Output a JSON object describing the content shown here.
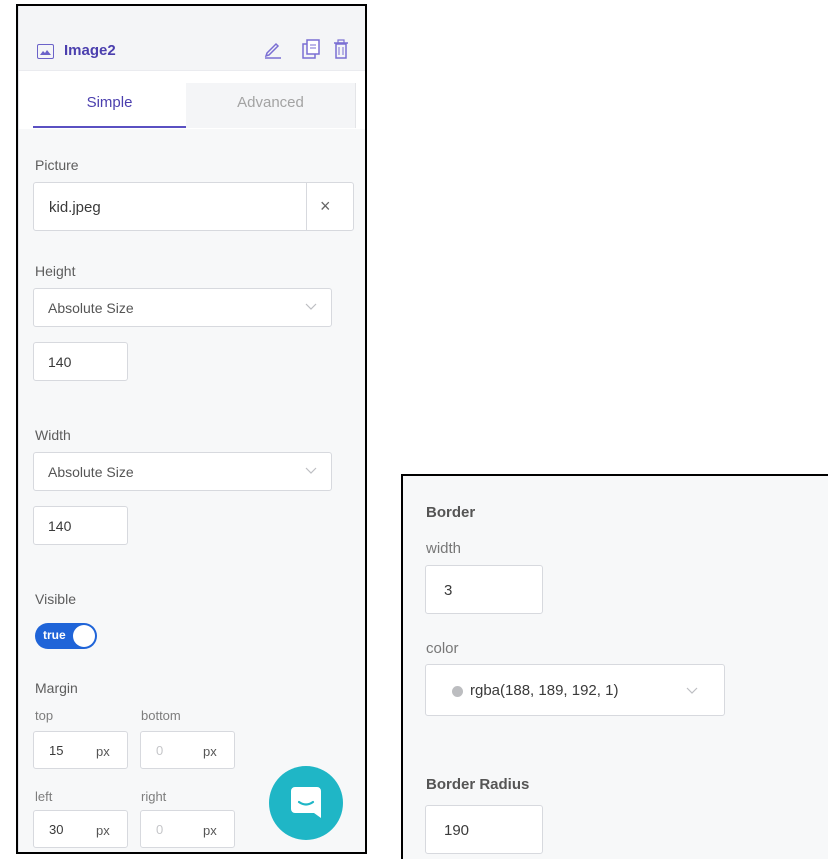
{
  "panel": {
    "title": "Image2",
    "tabs": [
      "Simple",
      "Advanced"
    ],
    "picture": {
      "label": "Picture",
      "value": "kid.jpeg",
      "clear_glyph": "×"
    },
    "height": {
      "label": "Height",
      "mode": "Absolute Size",
      "value": "140"
    },
    "width": {
      "label": "Width",
      "mode": "Absolute Size",
      "value": "140"
    },
    "visible": {
      "label": "Visible",
      "value": "true"
    },
    "margin": {
      "label": "Margin",
      "top": {
        "label": "top",
        "value": "15",
        "unit": "px"
      },
      "bottom": {
        "label": "bottom",
        "placeholder": "0",
        "unit": "px"
      },
      "left": {
        "label": "left",
        "value": "30",
        "unit": "px"
      },
      "right": {
        "label": "right",
        "placeholder": "0",
        "unit": "px"
      }
    }
  },
  "border_panel": {
    "title": "Border",
    "width": {
      "label": "width",
      "value": "3"
    },
    "color": {
      "label": "color",
      "value": "rgba(188, 189, 192, 1)",
      "swatch": "#bcbdc0"
    },
    "radius": {
      "label": "Border Radius",
      "value": "190"
    }
  },
  "icons": [
    "image-icon",
    "pencil-icon",
    "duplicate-icon",
    "trash-icon",
    "chevron-down-icon",
    "chat-icon"
  ],
  "colors": {
    "accent": "#4b3fae",
    "toggle": "#1f64d8",
    "chat": "#1fb6c6"
  }
}
